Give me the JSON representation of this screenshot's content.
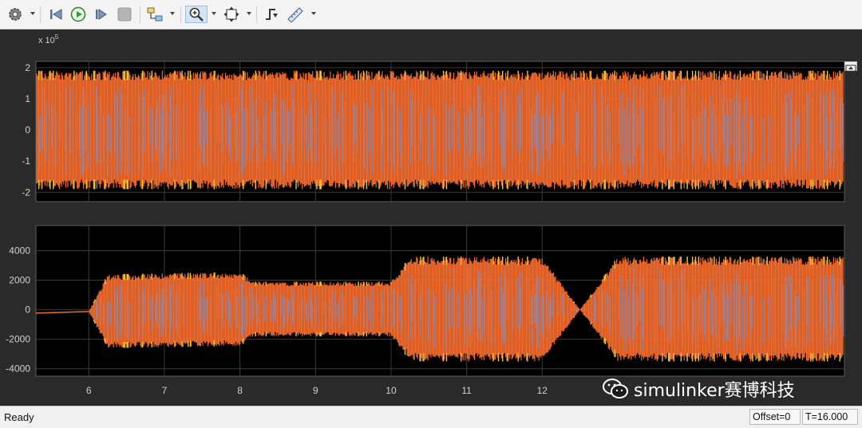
{
  "toolbar": {
    "buttons": [
      {
        "name": "settings",
        "icon": "gear-icon"
      },
      {
        "name": "step-back",
        "icon": "step-back-icon"
      },
      {
        "name": "run",
        "icon": "play-icon"
      },
      {
        "name": "step-forward",
        "icon": "step-forward-icon"
      },
      {
        "name": "stop",
        "icon": "stop-icon"
      },
      {
        "name": "highlight-block",
        "icon": "block-highlight-icon"
      },
      {
        "name": "zoom",
        "icon": "zoom-in-icon"
      },
      {
        "name": "autoscale",
        "icon": "autoscale-icon"
      },
      {
        "name": "triggers",
        "icon": "trigger-icon"
      },
      {
        "name": "measurements",
        "icon": "ruler-icon"
      }
    ]
  },
  "plots": {
    "top": {
      "exponent_label": "x 10",
      "exponent_power": "5"
    }
  },
  "chart_data": [
    {
      "type": "line",
      "title": "",
      "xlabel": "",
      "ylabel": "",
      "xlim": [
        5.3,
        16.0
      ],
      "ylim": [
        -2.3,
        2.2
      ],
      "y_exponent": 5,
      "yticks": [
        "2",
        "1",
        "0",
        "-1",
        "-2"
      ],
      "ytick_values": [
        2,
        1,
        0,
        -1,
        -2
      ],
      "grid": true,
      "background": "#000000",
      "series": [
        {
          "color": "#f26b2c",
          "values_description_amplitude": 1.9
        }
      ],
      "envelope": {
        "x": [
          5.3,
          16.0
        ],
        "upper": [
          1.9,
          1.9
        ],
        "lower": [
          -1.9,
          -1.9
        ]
      }
    },
    {
      "type": "line",
      "title": "",
      "xlabel": "",
      "ylabel": "",
      "xlim": [
        5.3,
        16.0
      ],
      "ylim": [
        -4500,
        5700
      ],
      "xticks": [
        "6",
        "7",
        "8",
        "9",
        "10",
        "11",
        "12"
      ],
      "xtick_values": [
        6,
        7,
        8,
        9,
        10,
        11,
        12
      ],
      "yticks": [
        "4000",
        "2000",
        "0",
        "-2000",
        "-4000"
      ],
      "ytick_values": [
        4000,
        2000,
        0,
        -2000,
        -4000
      ],
      "grid": true,
      "background": "#000000",
      "envelope": {
        "x": [
          5.3,
          6.0,
          6.25,
          8.0,
          8.2,
          10.0,
          10.25,
          12.0,
          12.5,
          13.0,
          16.0
        ],
        "upper": [
          -200,
          -100,
          2400,
          2550,
          1900,
          1900,
          3600,
          3600,
          0,
          3600,
          3600
        ],
        "lower": [
          -250,
          -150,
          -2600,
          -2450,
          -1800,
          -1800,
          -3500,
          -3500,
          0,
          -3500,
          -3500
        ]
      },
      "series": [
        {
          "color": "#f26b2c"
        }
      ]
    }
  ],
  "colors": {
    "series_orange": "#f26b2c",
    "series_blue": "#6f8fd0",
    "series_yellow": "#f5c23a",
    "plot_bg": "#000000",
    "axes_frame": "#2a2a2a"
  },
  "watermark": {
    "text": "simulinker赛博科技",
    "icon": "wechat-icon"
  },
  "status": {
    "text": "Ready",
    "offset": "Offset=0",
    "time": "T=16.000"
  }
}
